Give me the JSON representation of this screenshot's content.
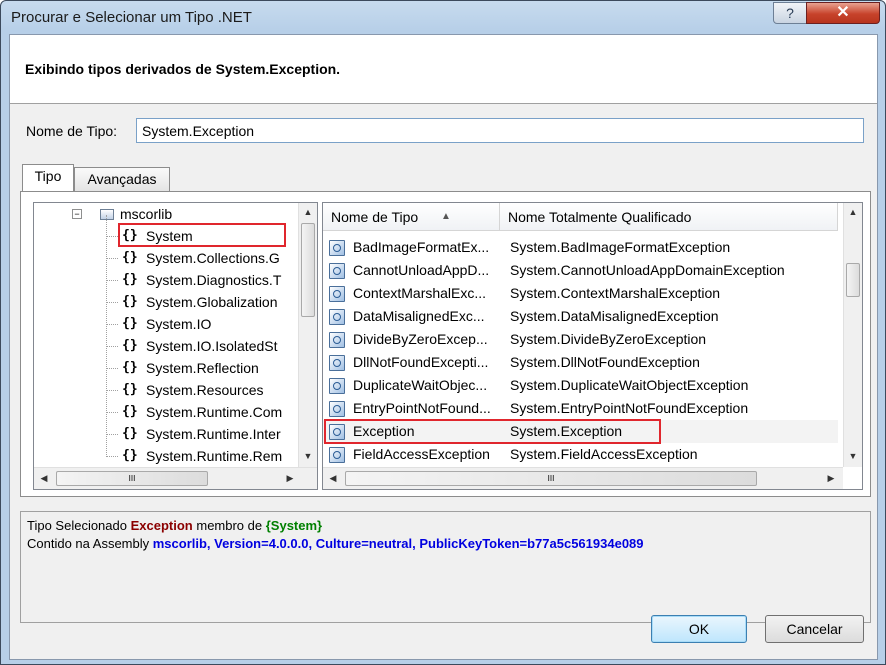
{
  "window": {
    "title": "Procurar e Selecionar um Tipo .NET",
    "help_glyph": "?",
    "close_glyph": "✕"
  },
  "header": {
    "text": "Exibindo tipos derivados de System.Exception."
  },
  "type_name": {
    "label": "Nome de Tipo:",
    "value": "System.Exception"
  },
  "tabs": [
    {
      "label": "Tipo"
    },
    {
      "label": "Avançadas"
    }
  ],
  "tree": {
    "root": "mscorlib",
    "items": [
      "System",
      "System.Collections.G",
      "System.Diagnostics.T",
      "System.Globalization",
      "System.IO",
      "System.IO.IsolatedSt",
      "System.Reflection",
      "System.Resources",
      "System.Runtime.Com",
      "System.Runtime.Inter",
      "System.Runtime.Rem"
    ],
    "scroll_glyph": "III"
  },
  "list": {
    "columns": [
      "Nome de Tipo",
      "Nome Totalmente Qualificado"
    ],
    "rows": [
      [
        "BadImageFormatEx...",
        "System.BadImageFormatException"
      ],
      [
        "CannotUnloadAppD...",
        "System.CannotUnloadAppDomainException"
      ],
      [
        "ContextMarshalExc...",
        "System.ContextMarshalException"
      ],
      [
        "DataMisalignedExc...",
        "System.DataMisalignedException"
      ],
      [
        "DivideByZeroExcep...",
        "System.DivideByZeroException"
      ],
      [
        "DllNotFoundExcepti...",
        "System.DllNotFoundException"
      ],
      [
        "DuplicateWaitObjec...",
        "System.DuplicateWaitObjectException"
      ],
      [
        "EntryPointNotFound...",
        "System.EntryPointNotFoundException"
      ],
      [
        "Exception",
        "System.Exception"
      ],
      [
        "FieldAccessException",
        "System.FieldAccessException"
      ]
    ],
    "scroll_glyph": "III"
  },
  "info": {
    "selected_prefix": "Tipo Selecionado",
    "selected_type": "Exception",
    "member_of": "membro de",
    "namespace": "{System}",
    "contained_prefix": "Contido na Assembly",
    "assembly": "mscorlib, Version=4.0.0.0, Culture=neutral, PublicKeyToken=b77a5c561934e089"
  },
  "buttons": {
    "ok": "OK",
    "cancel": "Cancelar"
  },
  "colors": {
    "highlight_box": "#e0262d",
    "type_red": "#8b0000",
    "namespace_green": "#008000",
    "assembly_blue": "#0000e0"
  }
}
